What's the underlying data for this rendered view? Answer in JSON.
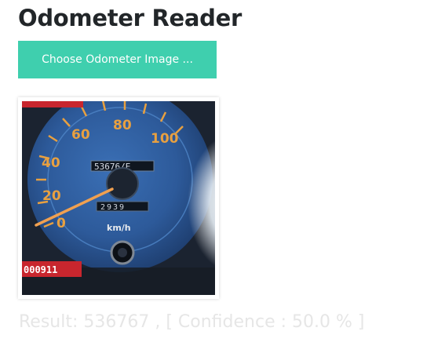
{
  "app": {
    "title": "Odometer Reader"
  },
  "upload": {
    "button_label": "Choose Odometer Image ..."
  },
  "preview": {
    "speed_labels": [
      "0",
      "20",
      "40",
      "60",
      "80",
      "100"
    ],
    "unit_label": "km/h",
    "odometer_digits": "53676/E",
    "trip_digits": "2939",
    "sticker_text": "000911"
  },
  "result": {
    "text": "Result: 536767 , [ Confidence : 50.0 % ]"
  },
  "colors": {
    "accent": "#3fcfae",
    "title": "#222629",
    "result_text": "#e6e6e6"
  }
}
